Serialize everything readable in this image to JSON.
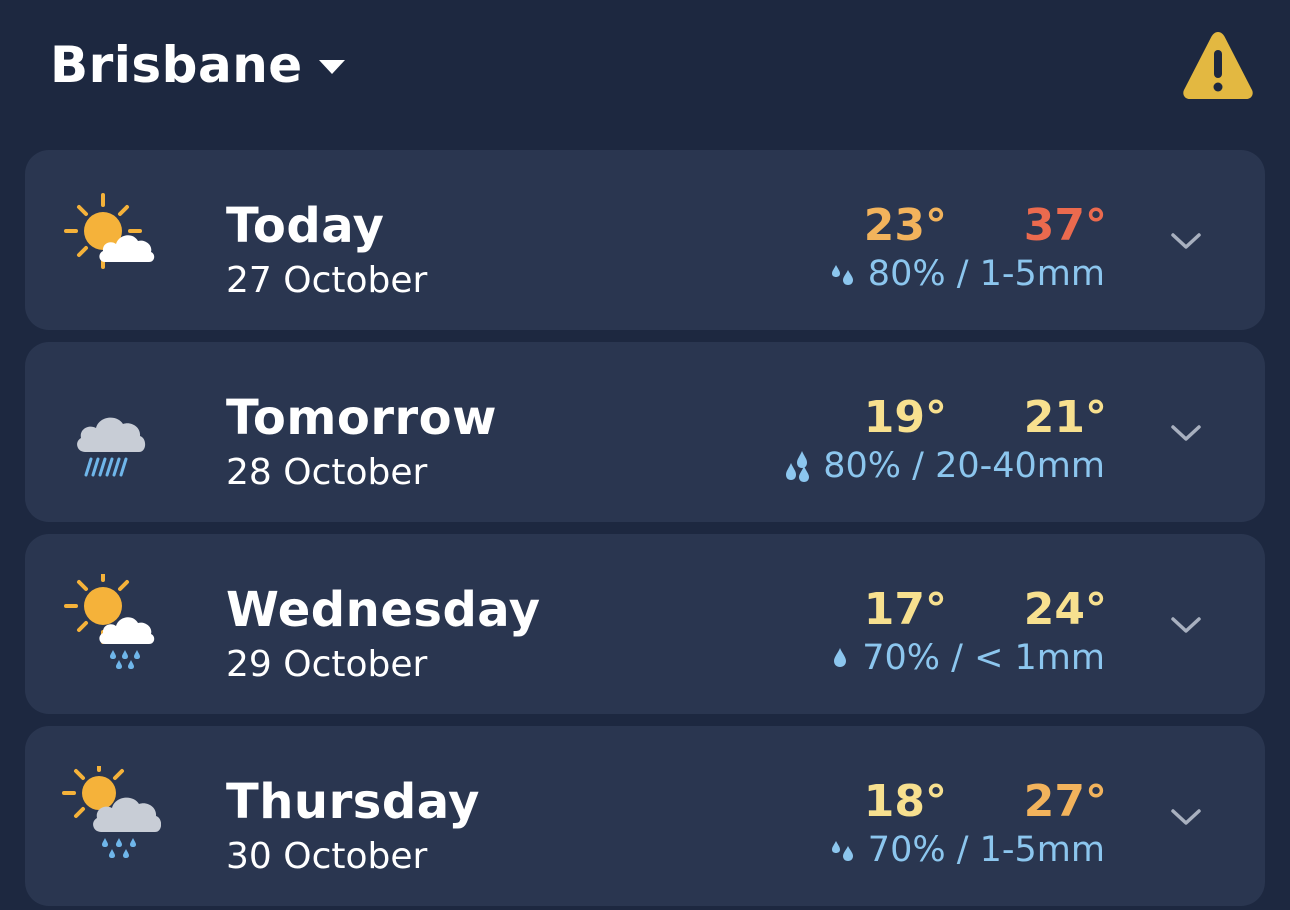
{
  "header": {
    "location": "Brisbane",
    "location_dropdown_icon": "caret-down-icon",
    "warning_icon": "warning-triangle-icon",
    "warning_color": "#e3b841"
  },
  "colors": {
    "background": "#1d2840",
    "card": "#2a3650",
    "temp_yellow": "#f7e08f",
    "temp_orange": "#f2b35c",
    "temp_red": "#eb6a4e",
    "rain_text": "#8cc6ee",
    "chevron": "#a8b0bf"
  },
  "forecast": [
    {
      "day": "Today",
      "date": "27 October",
      "icon": "partly-cloudy-icon",
      "min": "23°",
      "max": "37°",
      "min_color": "#f2b35c",
      "max_color": "#eb6a4e",
      "rain": "80% / 1-5mm",
      "rain_icon": "rain-drops-small-icon"
    },
    {
      "day": "Tomorrow",
      "date": "28 October",
      "icon": "heavy-rain-cloud-icon",
      "min": "19°",
      "max": "21°",
      "min_color": "#f7e08f",
      "max_color": "#f7e08f",
      "rain": "80% / 20-40mm",
      "rain_icon": "rain-drops-large-icon"
    },
    {
      "day": "Wednesday",
      "date": "29 October",
      "icon": "sun-showers-icon",
      "min": "17°",
      "max": "24°",
      "min_color": "#f7e08f",
      "max_color": "#f7e08f",
      "rain": "70% / < 1mm",
      "rain_icon": "rain-drop-single-icon"
    },
    {
      "day": "Thursday",
      "date": "30 October",
      "icon": "sun-cloud-showers-icon",
      "min": "18°",
      "max": "27°",
      "min_color": "#f7e08f",
      "max_color": "#f2b35c",
      "rain": "70% / 1-5mm",
      "rain_icon": "rain-drops-small-icon"
    }
  ]
}
